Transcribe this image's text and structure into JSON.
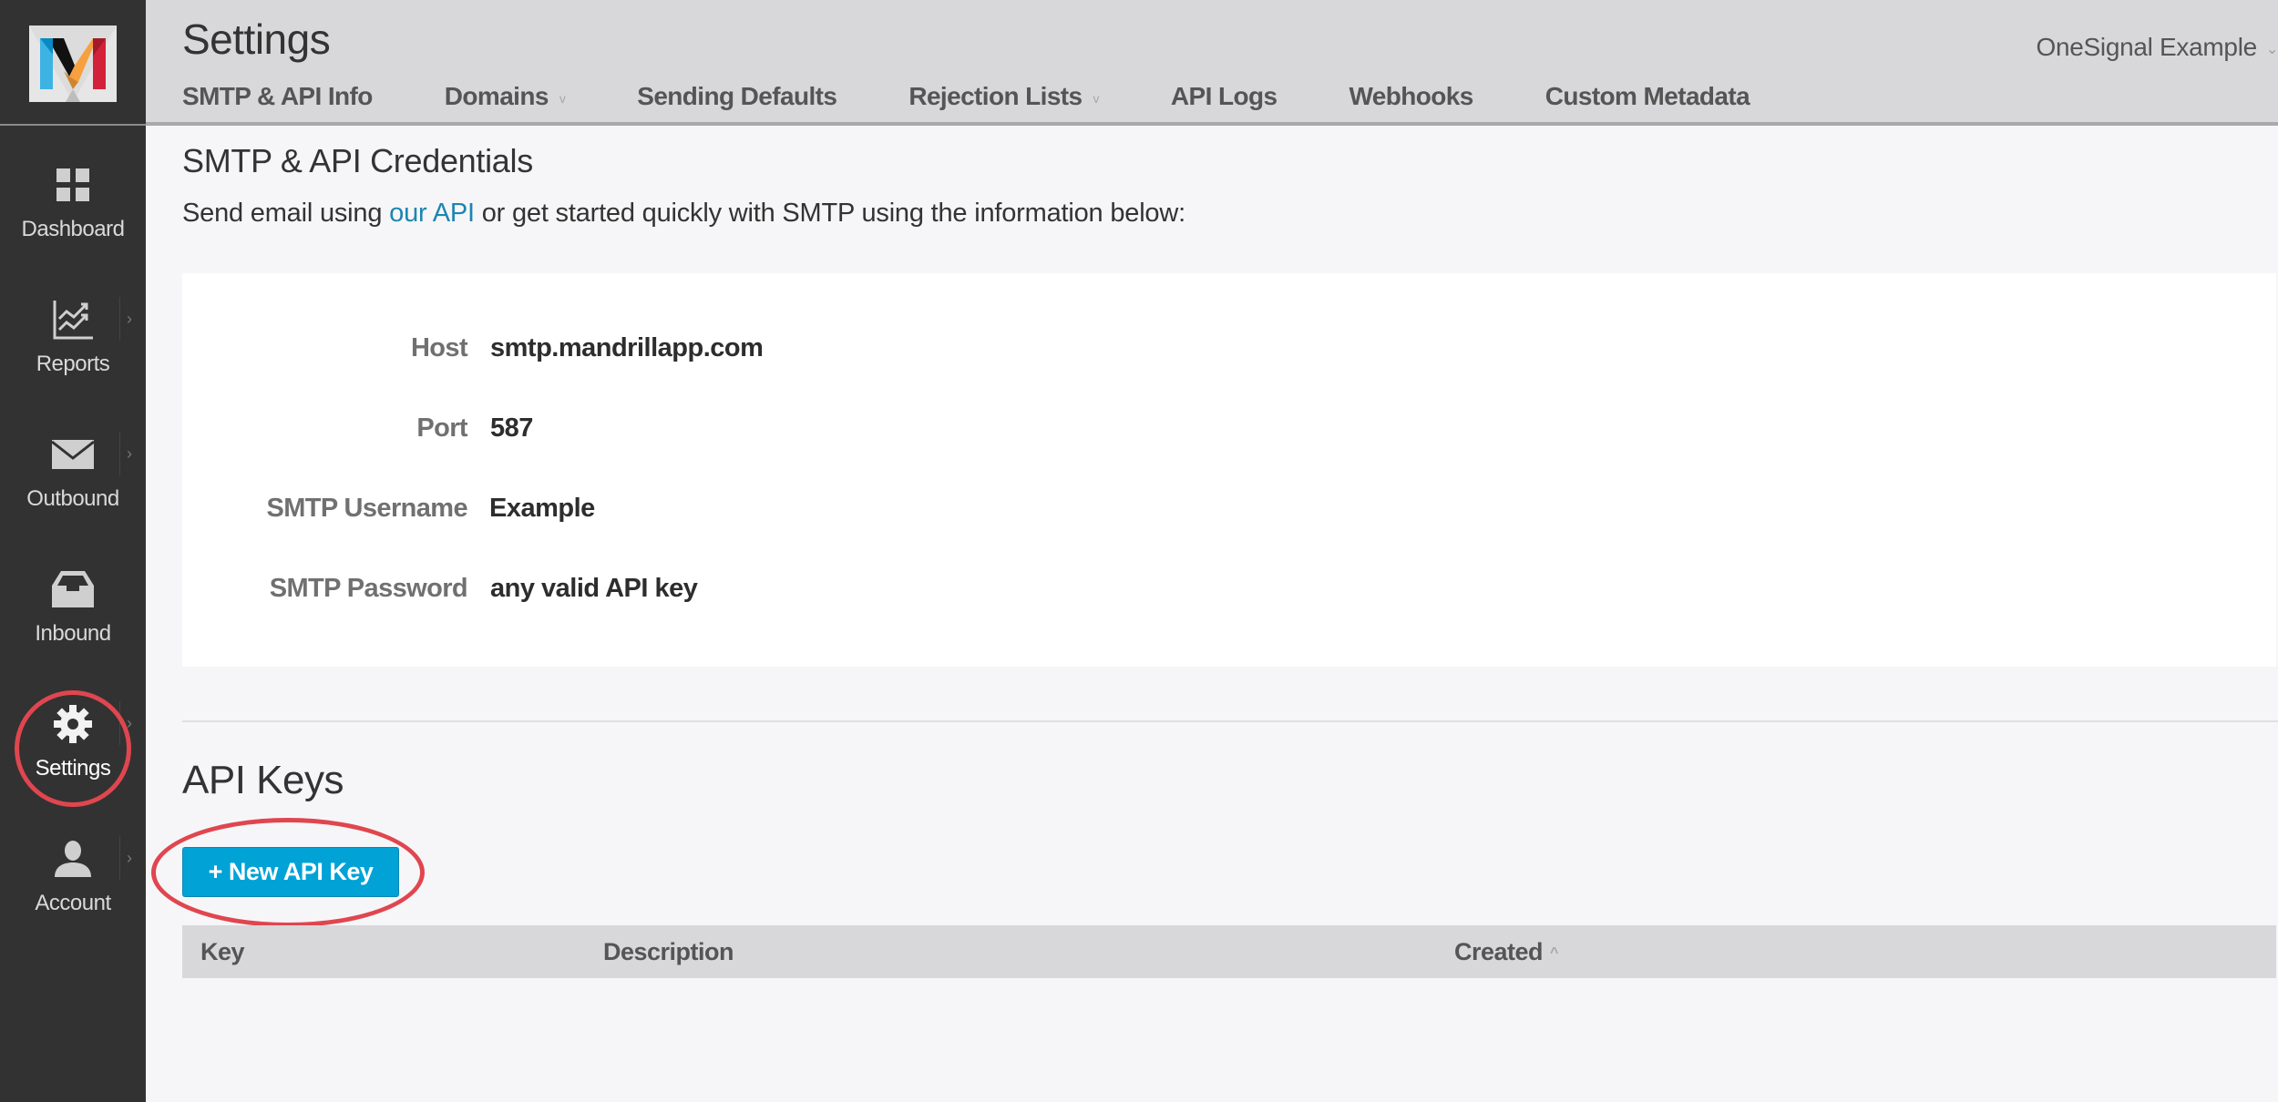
{
  "sidebar": {
    "logo_alt": "Mandrill",
    "items": [
      {
        "label": "Dashboard",
        "icon": "dashboard-grid-icon",
        "has_submenu": false,
        "active": false
      },
      {
        "label": "Reports",
        "icon": "chart-icon",
        "has_submenu": true,
        "active": false
      },
      {
        "label": "Outbound",
        "icon": "envelope-icon",
        "has_submenu": true,
        "active": false
      },
      {
        "label": "Inbound",
        "icon": "inbox-tray-icon",
        "has_submenu": false,
        "active": false
      },
      {
        "label": "Settings",
        "icon": "gear-icon",
        "has_submenu": true,
        "active": true
      },
      {
        "label": "Account",
        "icon": "user-icon",
        "has_submenu": true,
        "active": false
      }
    ],
    "chevron_glyph": "›"
  },
  "header": {
    "title": "Settings",
    "account_name": "OneSignal Example",
    "account_chevron": "⌄",
    "tabs": [
      {
        "label": "SMTP & API Info",
        "dropdown": false,
        "active": true
      },
      {
        "label": "Domains",
        "dropdown": true
      },
      {
        "label": "Sending Defaults",
        "dropdown": false
      },
      {
        "label": "Rejection Lists",
        "dropdown": true
      },
      {
        "label": "API Logs",
        "dropdown": false
      },
      {
        "label": "Webhooks",
        "dropdown": false
      },
      {
        "label": "Custom Metadata",
        "dropdown": false
      }
    ],
    "dropdown_glyph": "v"
  },
  "credentials": {
    "title": "SMTP & API Credentials",
    "intro_before": "Send email using ",
    "intro_link": "our API",
    "intro_after": " or get started quickly with SMTP using the information below:",
    "rows": [
      {
        "label": "Host",
        "value": "smtp.mandrillapp.com"
      },
      {
        "label": "Port",
        "value": "587"
      },
      {
        "label": "SMTP Username",
        "value": "Example"
      },
      {
        "label": "SMTP Password",
        "value": "any valid API key"
      }
    ]
  },
  "api_keys": {
    "title": "API Keys",
    "new_button_label": "+ New API Key",
    "columns": [
      {
        "label": "Key",
        "sorted": false
      },
      {
        "label": "Description",
        "sorted": false
      },
      {
        "label": "Created",
        "sorted": true,
        "sort_glyph": "^"
      }
    ],
    "rows": []
  },
  "colors": {
    "sidebar_bg": "#323232",
    "header_bg": "#d8d8da",
    "content_bg": "#f6f6f8",
    "link": "#1c86b0",
    "primary_button": "#01a2d6",
    "annotation_red": "#e0464f"
  }
}
